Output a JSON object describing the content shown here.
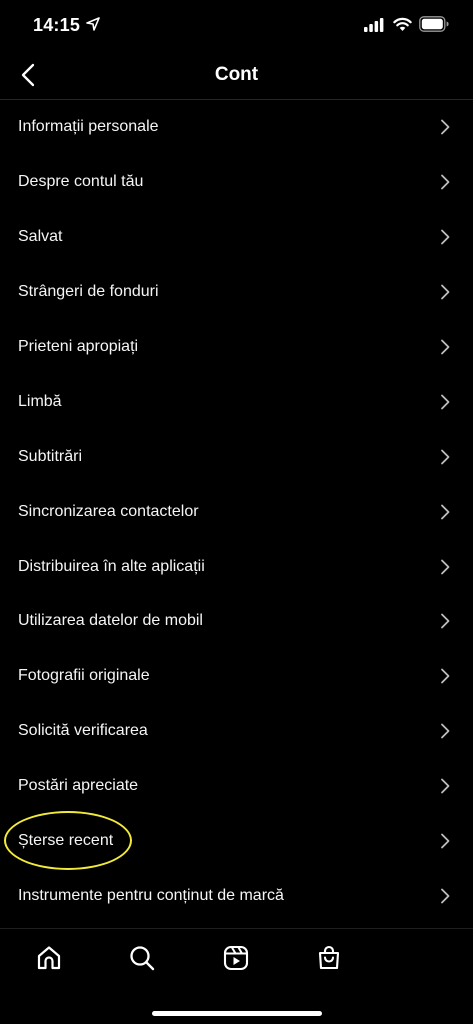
{
  "status_bar": {
    "time": "14:15"
  },
  "header": {
    "title": "Cont"
  },
  "menu": {
    "items": [
      {
        "label": "Informații personale"
      },
      {
        "label": "Despre contul tău"
      },
      {
        "label": "Salvat"
      },
      {
        "label": "Strângeri de fonduri"
      },
      {
        "label": "Prieteni apropiați"
      },
      {
        "label": "Limbă"
      },
      {
        "label": "Subtitrări"
      },
      {
        "label": "Sincronizarea contactelor"
      },
      {
        "label": "Distribuirea în alte aplicații"
      },
      {
        "label": "Utilizarea datelor de mobil"
      },
      {
        "label": "Fotografii originale"
      },
      {
        "label": "Solicită verificarea"
      },
      {
        "label": "Postări apreciate"
      },
      {
        "label": "Șterse recent",
        "highlighted": true
      },
      {
        "label": "Instrumente pentru conținut de marcă"
      }
    ]
  },
  "bottom_nav": [
    "home-icon",
    "search-icon",
    "reels-icon",
    "shop-icon"
  ],
  "colors": {
    "background": "#000000",
    "highlight": "#f2ea3a",
    "text": "#ffffff",
    "chevron": "#bdbdbd"
  }
}
